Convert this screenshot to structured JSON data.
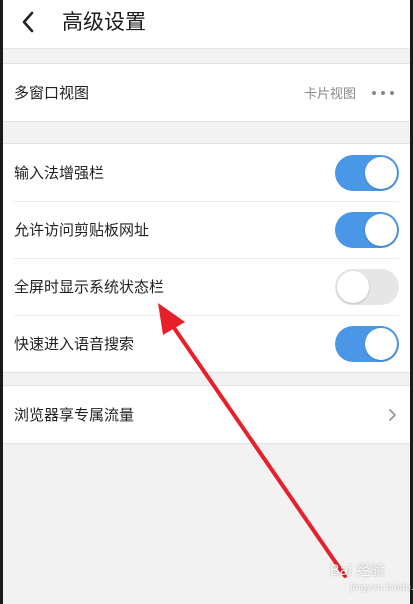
{
  "header": {
    "title": "高级设置",
    "back_icon": "chevron-left-icon"
  },
  "sections": [
    {
      "rows": [
        {
          "label": "多窗口视图",
          "value": "卡片视图",
          "more_icon": "more-dots-icon"
        }
      ]
    },
    {
      "rows": [
        {
          "label": "输入法增强栏",
          "toggle": true
        },
        {
          "label": "允许访问剪贴板网址",
          "toggle": true
        },
        {
          "label": "全屏时显示系统状态栏",
          "toggle": false
        },
        {
          "label": "快速进入语音搜索",
          "toggle": true
        }
      ]
    },
    {
      "rows": [
        {
          "label": "浏览器享专属流量",
          "chevron_icon": "chevron-right-icon"
        }
      ]
    }
  ],
  "colors": {
    "toggle_on": "#4a97e8",
    "toggle_off": "#e6e6e6",
    "annotation_arrow": "#e8202a"
  },
  "watermark": {
    "text": "Bai 经验",
    "sub": "jingyan.baidu.com"
  }
}
